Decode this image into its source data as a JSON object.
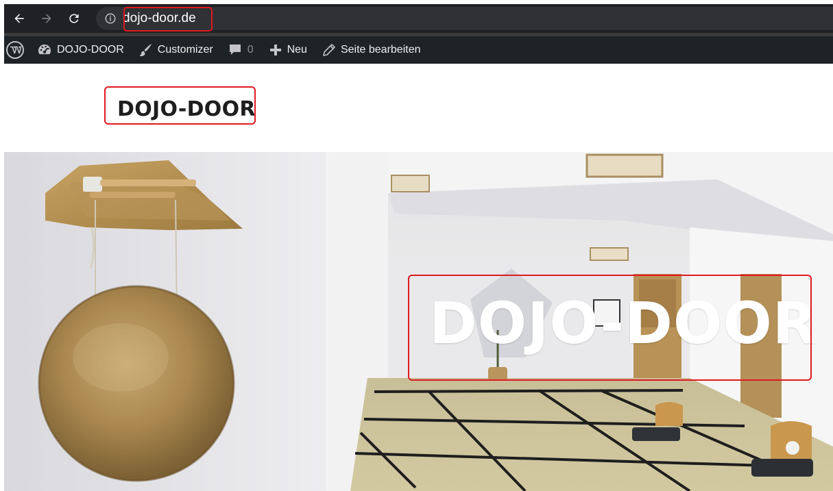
{
  "browser": {
    "url": "dojo-door.de",
    "icons": {
      "back": "arrow-left-icon",
      "forward": "arrow-right-icon",
      "reload": "reload-icon",
      "site_info": "info-icon"
    }
  },
  "admin_bar": {
    "site_name": "DOJO-DOOR",
    "customizer": "Customizer",
    "comments_count": "0",
    "new": "Neu",
    "edit_page": "Seite bearbeiten"
  },
  "site": {
    "title": "DOJO-DOOR"
  },
  "hero": {
    "title": "DOJO-DOOR"
  },
  "colors": {
    "chrome_bg": "#202124",
    "omnibox_bg": "#303134",
    "wp_bar_bg": "#1d2327",
    "highlight": "#e0191f",
    "title_text": "#1e1e1e"
  }
}
